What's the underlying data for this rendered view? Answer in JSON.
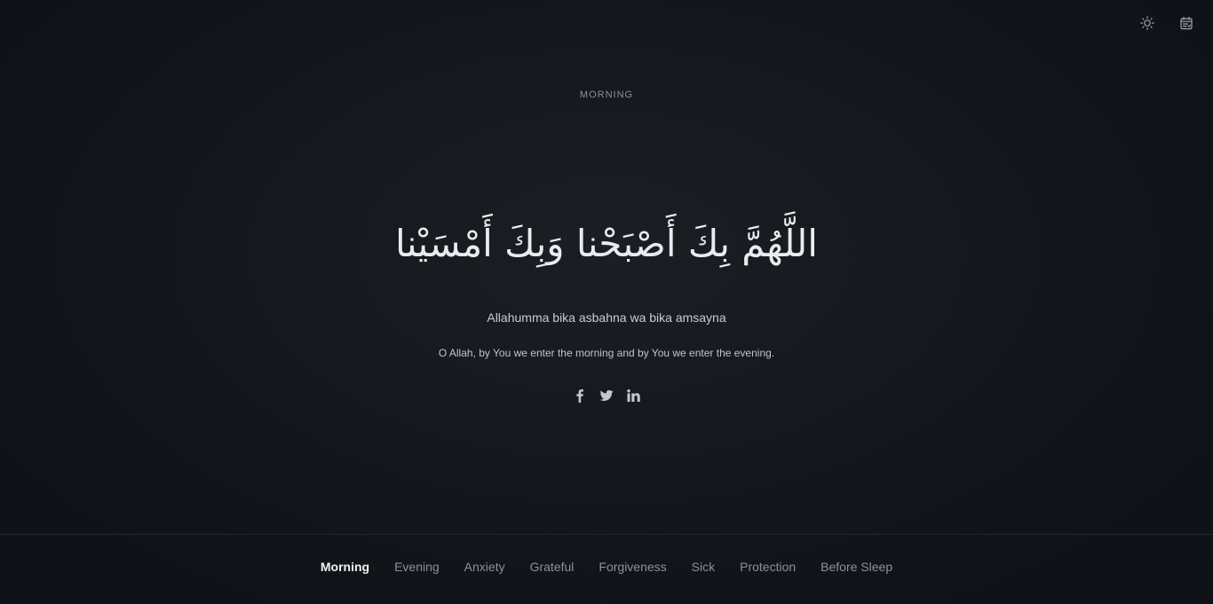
{
  "header": {
    "icons": [
      "sun-icon",
      "calendar-icon"
    ]
  },
  "dua": {
    "category": "MORNING",
    "arabic": "اللَّهُمَّ بِكَ أَصْبَحْنا وَبِكَ أَمْسَيْنا",
    "transliteration": "Allahumma bika asbahna wa bika amsayna",
    "translation": "O Allah, by You we enter the morning and by You we enter the evening."
  },
  "share": {
    "icons": [
      "facebook-icon",
      "twitter-icon",
      "linkedin-icon"
    ]
  },
  "nav": {
    "items": [
      {
        "label": "Morning",
        "active": true
      },
      {
        "label": "Evening",
        "active": false
      },
      {
        "label": "Anxiety",
        "active": false
      },
      {
        "label": "Grateful",
        "active": false
      },
      {
        "label": "Forgiveness",
        "active": false
      },
      {
        "label": "Sick",
        "active": false
      },
      {
        "label": "Protection",
        "active": false
      },
      {
        "label": "Before Sleep",
        "active": false
      }
    ]
  },
  "colors": {
    "background": "#111419",
    "active_nav": "#f1f2f4",
    "inactive_nav": "#8d9198"
  }
}
